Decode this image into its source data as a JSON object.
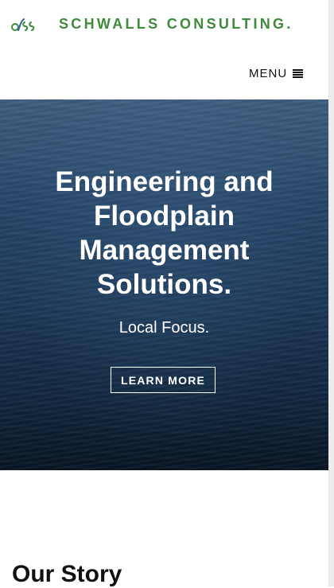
{
  "header": {
    "brand": "SCHWALLS CONSULTING.",
    "logo_icon": "ss-leaf-logo-icon",
    "menu_label": "MENU",
    "menu_icon": "hamburger-icon"
  },
  "hero": {
    "title": "Engineering and Floodplain Management Solutions.",
    "subtitle": "Local Focus.",
    "button_label": "LEARN MORE"
  },
  "story": {
    "title": "Our Story"
  },
  "colors": {
    "brand_green": "#3f8a3b",
    "logo_blue": "#2f5fa8"
  }
}
